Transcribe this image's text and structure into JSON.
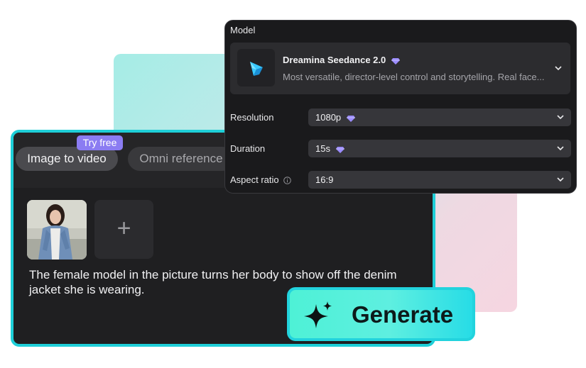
{
  "tabs": {
    "image_to_video": "Image to video",
    "omni_reference": "Omni reference",
    "badge": "Try free"
  },
  "prompt": {
    "text": "The female model in the picture turns her body to show off the denim jacket she is wearing.",
    "add_symbol": "+"
  },
  "generate": {
    "label": "Generate"
  },
  "settings": {
    "title": "Model",
    "model": {
      "name": "Dreamina Seedance 2.0",
      "description": "Most versatile, director-level control and storytelling. Real face..."
    },
    "resolution": {
      "label": "Resolution",
      "value": "1080p"
    },
    "duration": {
      "label": "Duration",
      "value": "15s"
    },
    "aspect_ratio": {
      "label": "Aspect ratio",
      "value": "16:9"
    }
  },
  "colors": {
    "accent_cyan": "#1ecfd8",
    "badge_purple": "#8b7cf2",
    "gem_purple": "#9b8cff",
    "panel_bg": "#1a1a1c"
  },
  "icons": [
    "sparkle-icon",
    "diamond-gem-icon",
    "chevron-down-icon",
    "info-icon",
    "plus-icon",
    "model-logo-icon"
  ]
}
